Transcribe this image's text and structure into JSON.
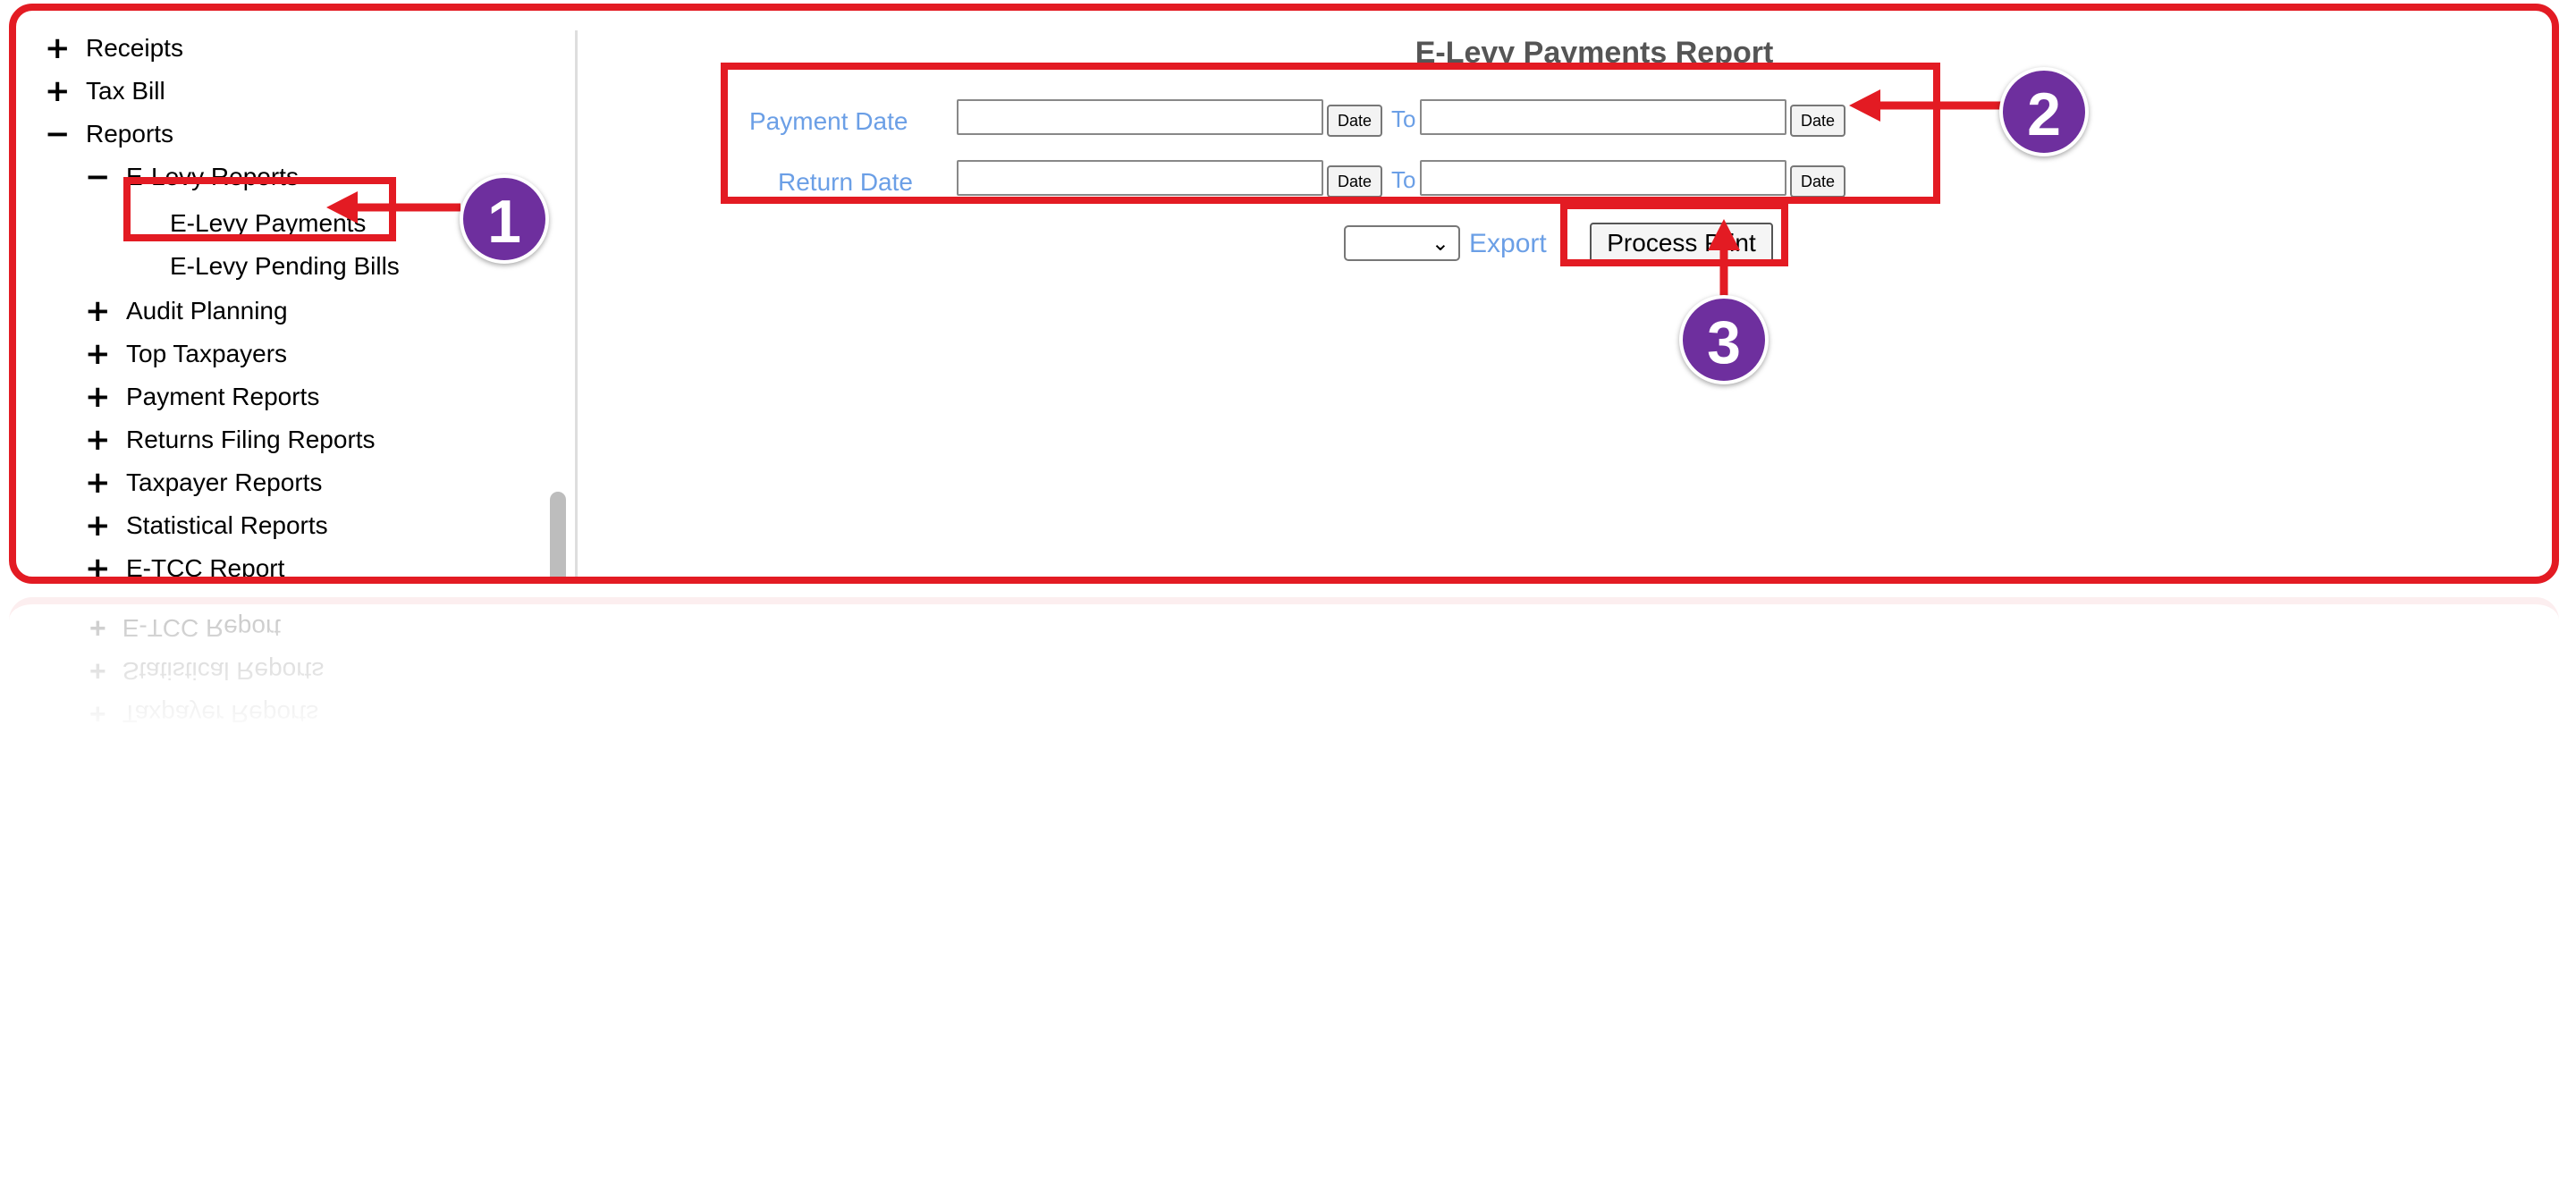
{
  "sidebar": {
    "items": [
      {
        "icon": "plus-icon",
        "glyph": "+",
        "label": "Receipts"
      },
      {
        "icon": "plus-icon",
        "glyph": "+",
        "label": "Tax Bill"
      },
      {
        "icon": "minus-icon",
        "glyph": "−",
        "label": "Reports"
      },
      {
        "icon": "minus-icon",
        "glyph": "−",
        "label": "E-Levy Reports"
      },
      {
        "label": "E-Levy Payments"
      },
      {
        "label": "E-Levy Pending Bills"
      },
      {
        "icon": "plus-icon",
        "glyph": "+",
        "label": "Audit Planning"
      },
      {
        "icon": "plus-icon",
        "glyph": "+",
        "label": "Top Taxpayers"
      },
      {
        "icon": "plus-icon",
        "glyph": "+",
        "label": "Payment Reports"
      },
      {
        "icon": "plus-icon",
        "glyph": "+",
        "label": "Returns Filing Reports"
      },
      {
        "icon": "plus-icon",
        "glyph": "+",
        "label": "Taxpayer Reports"
      },
      {
        "icon": "plus-icon",
        "glyph": "+",
        "label": "Statistical Reports"
      },
      {
        "icon": "plus-icon",
        "glyph": "+",
        "label": "E-TCC Report"
      }
    ]
  },
  "report": {
    "title": "E-Levy Payments Report",
    "payment_date_label": "Payment Date",
    "return_date_label": "Return Date",
    "to_label": "To",
    "date_button": "Date",
    "export_label": "Export",
    "process_button": "Process Print"
  },
  "annotations": {
    "badges": [
      "1",
      "2",
      "3"
    ],
    "color": "#e31b23",
    "badge_color": "#6e2f9e"
  },
  "colors": {
    "label_blue": "#6b9fe6",
    "title_gray": "#555555"
  }
}
